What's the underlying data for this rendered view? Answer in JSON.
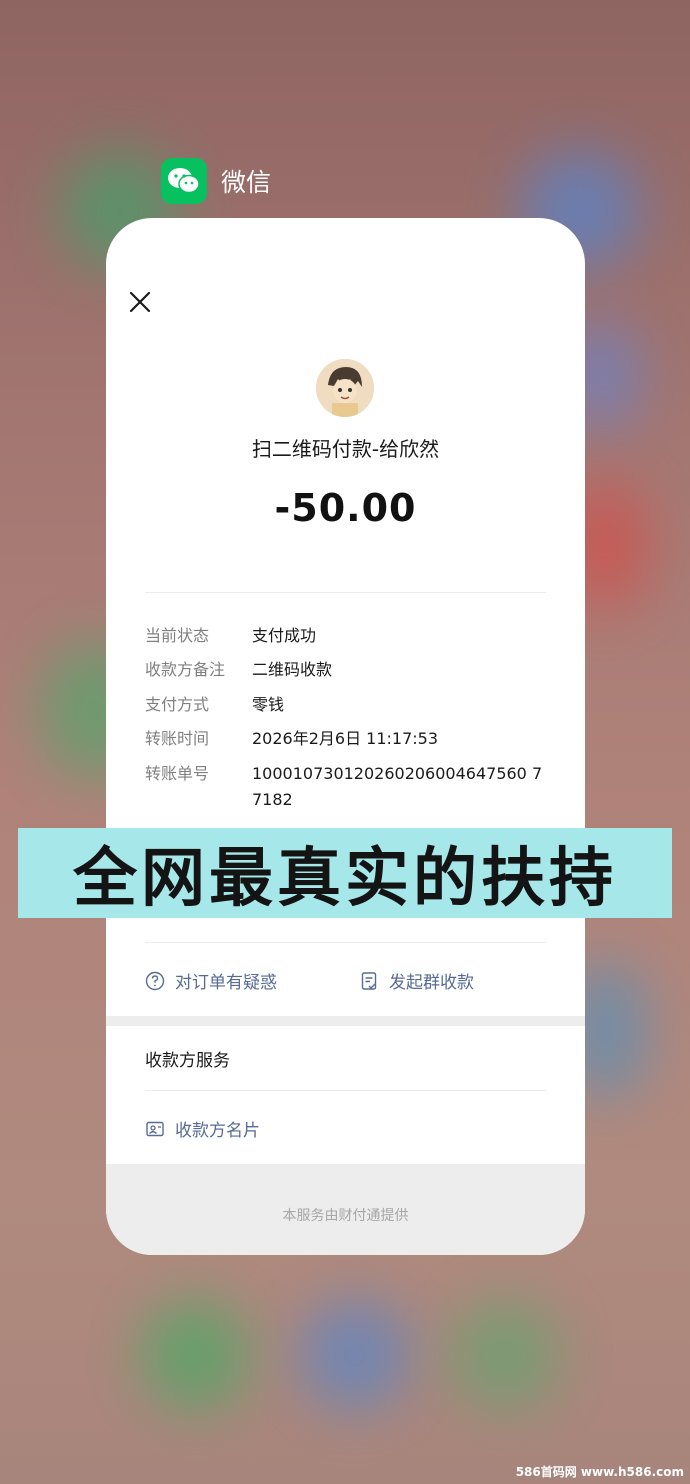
{
  "app": {
    "name": "微信",
    "icon": "wechat-logo-icon"
  },
  "payment": {
    "title": "扫二维码付款-给欣然",
    "amount": "-50.00"
  },
  "details": [
    {
      "label": "当前状态",
      "value": "支付成功"
    },
    {
      "label": "收款方备注",
      "value": "二维码收款"
    },
    {
      "label": "支付方式",
      "value": "零钱"
    },
    {
      "label": "转账时间",
      "value": "2026年2月6日 11:17:53"
    },
    {
      "label": "转账单号",
      "value": "100010730120260206004647560 77182"
    }
  ],
  "overlay_caption": "全网最真实的扶持",
  "actions": {
    "question": "对订单有疑惑",
    "group_collect": "发起群收款"
  },
  "payee_service": {
    "title": "收款方服务",
    "card_link": "收款方名片"
  },
  "footer": "本服务由财付通提供",
  "watermark": "586首码网 www.h586.com",
  "colors": {
    "accent_link": "#576b95",
    "wechat_green": "#07c160",
    "caption_bg": "#a6e8ea"
  }
}
